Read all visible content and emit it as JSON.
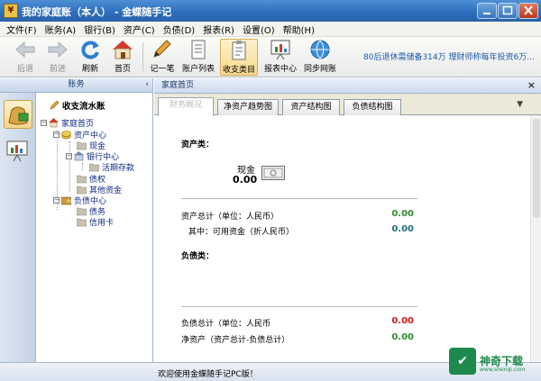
{
  "window": {
    "title": "我的家庭账（本人） - 金蝶随手记",
    "min_icon": "minimize-icon",
    "max_icon": "maximize-icon",
    "close_icon": "close-icon"
  },
  "menu": [
    "文件(F)",
    "账务(A)",
    "银行(B)",
    "资产(C)",
    "负债(D)",
    "报表(R)",
    "设置(O)",
    "帮助(H)"
  ],
  "toolbar": {
    "back": "后退",
    "forward": "前进",
    "refresh": "刷新",
    "home": "首页",
    "quick_entry": "记一笔",
    "accounts": "账户列表",
    "categories": "收支类目",
    "reports": "报表中心",
    "sync": "同步网账",
    "ticker": "80后退休需储备314万   理财师称每年投资6万..."
  },
  "left_panel": {
    "header": "账务",
    "collapse": "‹",
    "tree": {
      "journal": "收支流水账",
      "home": "家庭首页",
      "assets": "资产中心",
      "cash": "现金",
      "bank": "银行中心",
      "deposit": "活期存款",
      "claims": "债权",
      "other": "其他资金",
      "liabilities": "负债中心",
      "debts": "债务",
      "credit_card": "信用卡"
    }
  },
  "main": {
    "header": "家庭首页",
    "close": "×",
    "tabs": [
      "财务概况",
      "净资产趋势图",
      "资产结构图",
      "负债结构图"
    ],
    "tab_menu": "▼",
    "assets_title": "资产类：",
    "cash_label": "现金",
    "cash_value": "0.00",
    "asset_total_label": "资产总计（单位：人民币）",
    "asset_total_value": "0.00",
    "available_label": "其中：可用资金（折人民币）",
    "available_value": "0.00",
    "liab_title": "负债类：",
    "liab_total_label": "负债总计（单位：人民币",
    "liab_total_value": "0.00",
    "net_label": "净资产（资产总计-负债总计）",
    "net_value": "0.00"
  },
  "status": {
    "text": "欢迎使用金蝶随手记PC版！"
  },
  "watermark": {
    "text": "神奇下载",
    "url": "www.shenqi.com"
  },
  "colors": {
    "positive": "#2e8b2e",
    "available": "#1f6f7a",
    "negative": "#cc1b1b",
    "titlebar": "#2d6fbd"
  }
}
